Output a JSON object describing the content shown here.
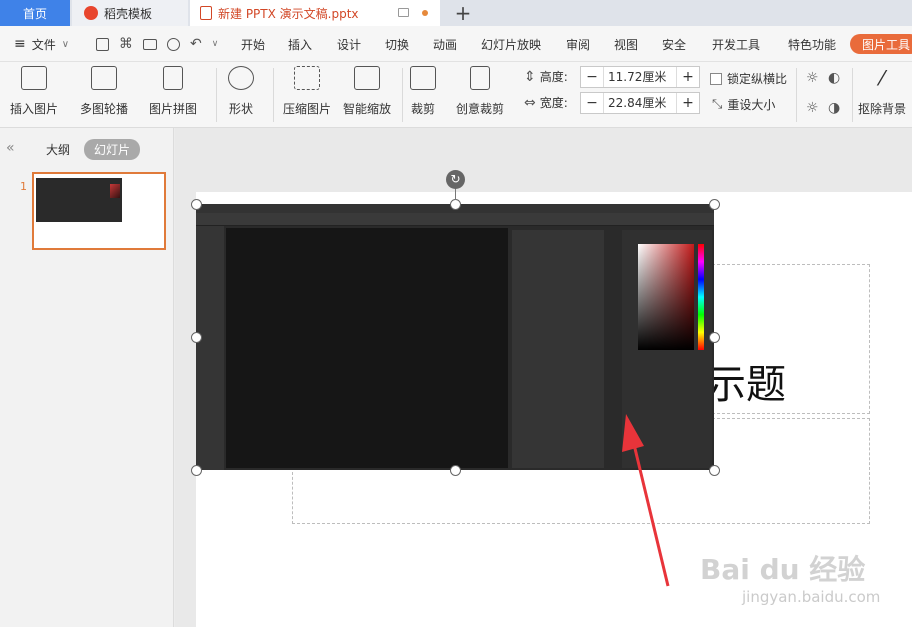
{
  "tabs": {
    "home": "首页",
    "templates": "稻壳模板",
    "document": "新建 PPTX 演示文稿.pptx",
    "new_tab": "+"
  },
  "menubar": {
    "file": "文件",
    "items": [
      "开始",
      "插入",
      "设计",
      "切换",
      "动画",
      "幻灯片放映",
      "审阅",
      "视图",
      "安全",
      "开发工具",
      "特色功能"
    ],
    "active_tab": "图片工具"
  },
  "ribbon": {
    "insert_picture": "插入图片",
    "multi_carousel": "多图轮播",
    "picture_collage": "图片拼图",
    "shape": "形状",
    "compress_picture": "压缩图片",
    "smart_zoom": "智能缩放",
    "crop": "裁剪",
    "creative_crop": "创意裁剪",
    "height_label": "高度:",
    "height_value": "11.72厘米",
    "width_label": "宽度:",
    "width_value": "22.84厘米",
    "lock_ratio": "锁定纵横比",
    "reset_size": "重设大小",
    "remove_background": "抠除背景",
    "minus": "−",
    "plus": "+"
  },
  "left_panel": {
    "collapse": "«",
    "outline_tab": "大纲",
    "slides_tab": "幻灯片",
    "slide_number": "1"
  },
  "slide": {
    "title_fragment": "示题"
  },
  "watermark": {
    "brand": "Bai du 经验",
    "url": "jingyan.baidu.com"
  },
  "colors": {
    "home_tab": "#3f82e8",
    "doc_tab_text": "#d24726",
    "picture_tools_tab": "#e96b3b",
    "slide_thumb_border": "#e07a3a",
    "arrow": "#e8343a"
  }
}
